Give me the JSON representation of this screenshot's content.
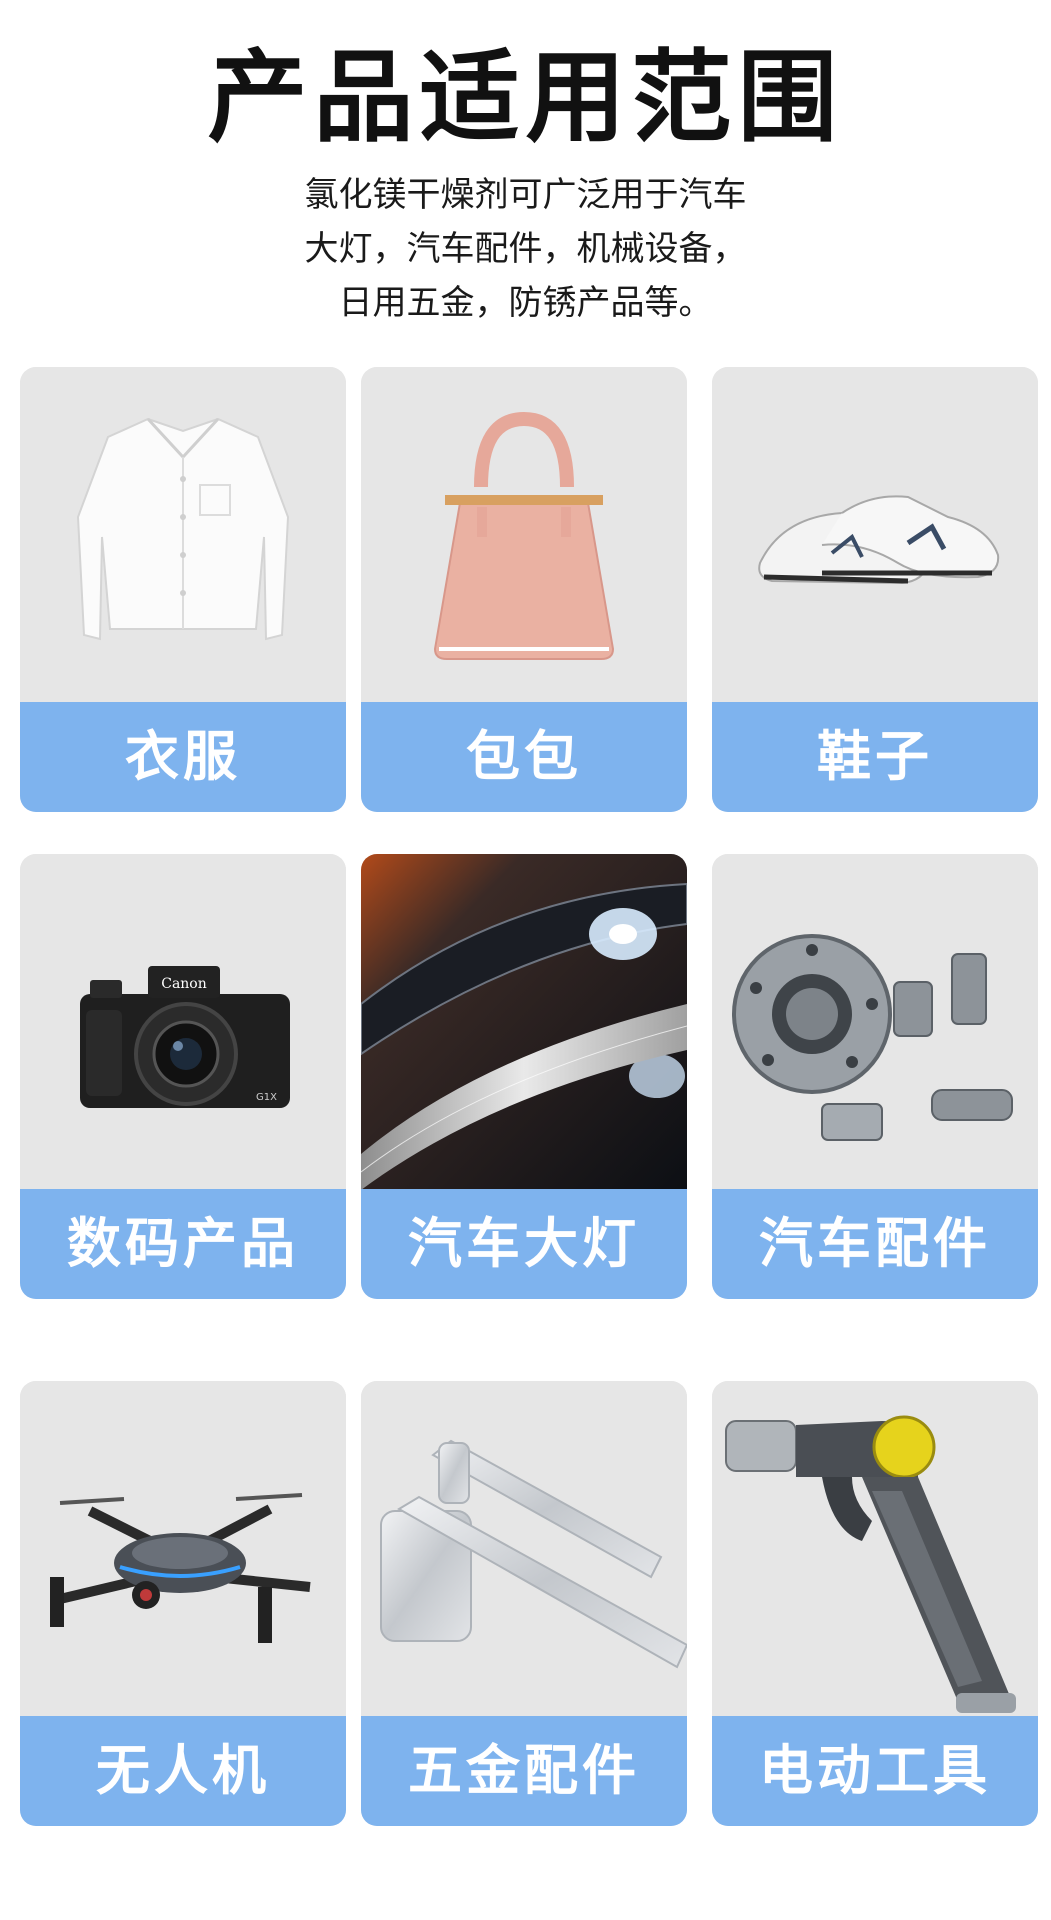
{
  "title": "产品适用范围",
  "description": {
    "line1": "氯化镁干燥剂可广泛用于汽车",
    "line2": "大灯，汽车配件，机械设备，",
    "line3": "日用五金，防锈产品等。"
  },
  "items": [
    {
      "label": "衣服",
      "icon": "shirt-image"
    },
    {
      "label": "包包",
      "icon": "handbag-image"
    },
    {
      "label": "鞋子",
      "icon": "sneakers-image"
    },
    {
      "label": "数码产品",
      "icon": "camera-image"
    },
    {
      "label": "汽车大灯",
      "icon": "headlight-image"
    },
    {
      "label": "汽车配件",
      "icon": "metal-parts-image"
    },
    {
      "label": "无人机",
      "icon": "drone-image"
    },
    {
      "label": "五金配件",
      "icon": "door-handle-image"
    },
    {
      "label": "电动工具",
      "icon": "spray-gun-image"
    }
  ],
  "colors": {
    "label_bg": "#7eb3ee",
    "card_bg": "#e6e6e6",
    "title": "#111111"
  }
}
